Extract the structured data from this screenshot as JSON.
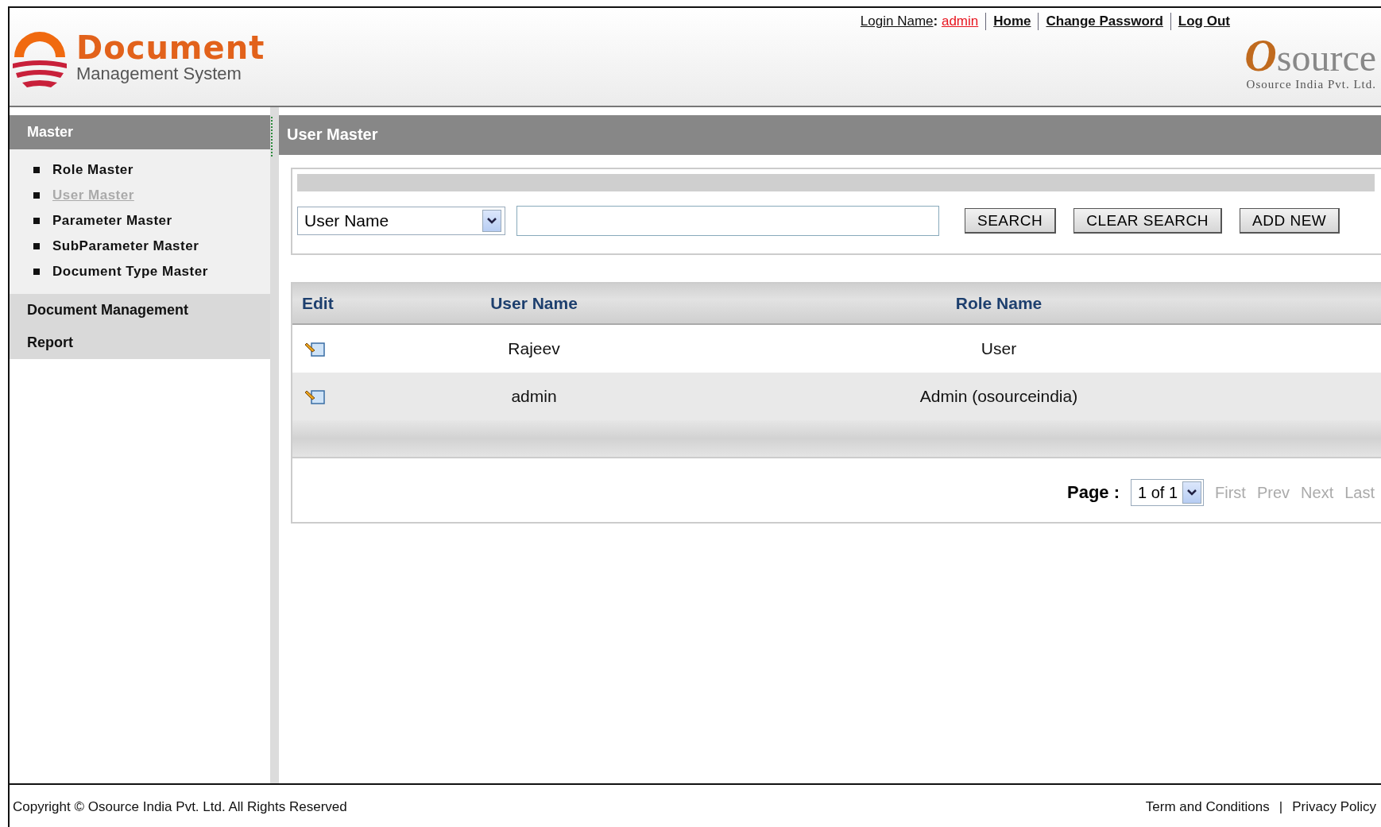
{
  "header": {
    "logo_title": "Document",
    "logo_subtitle": "Management System",
    "login_label": "Login Name",
    "login_colon": ":",
    "login_value": "admin",
    "links": [
      "Home",
      "Change Password",
      "Log Out"
    ],
    "brand_name": "source",
    "brand_initial": "O",
    "brand_tagline": "Osource India Pvt. Ltd."
  },
  "sidebar": {
    "groups": [
      {
        "label": "Master",
        "expanded": true,
        "items": [
          {
            "label": "Role Master",
            "selected": false
          },
          {
            "label": "User Master",
            "selected": true
          },
          {
            "label": "Parameter Master",
            "selected": false
          },
          {
            "label": "SubParameter Master",
            "selected": false
          },
          {
            "label": "Document Type Master",
            "selected": false
          }
        ]
      },
      {
        "label": "Document Management",
        "expanded": false
      },
      {
        "label": "Report",
        "expanded": false
      }
    ]
  },
  "main": {
    "title": "User Master",
    "search": {
      "field": "User Name",
      "buttons": [
        "SEARCH",
        "CLEAR SEARCH",
        "ADD NEW"
      ]
    },
    "table": {
      "columns": [
        "Edit",
        "User Name",
        "Role Name"
      ],
      "rows": [
        {
          "user_name": "Rajeev",
          "role_name": "User"
        },
        {
          "user_name": "admin",
          "role_name": "Admin (osourceindia)"
        }
      ]
    },
    "pager": {
      "label": "Page :",
      "value": "1 of 1",
      "links": [
        "First",
        "Prev",
        "Next",
        "Last"
      ]
    }
  },
  "footer": {
    "copyright": "Copyright © Osource India Pvt. Ltd. All Rights Reserved",
    "separator": "|",
    "links": [
      "Term and Conditions",
      "Privacy Policy"
    ]
  }
}
